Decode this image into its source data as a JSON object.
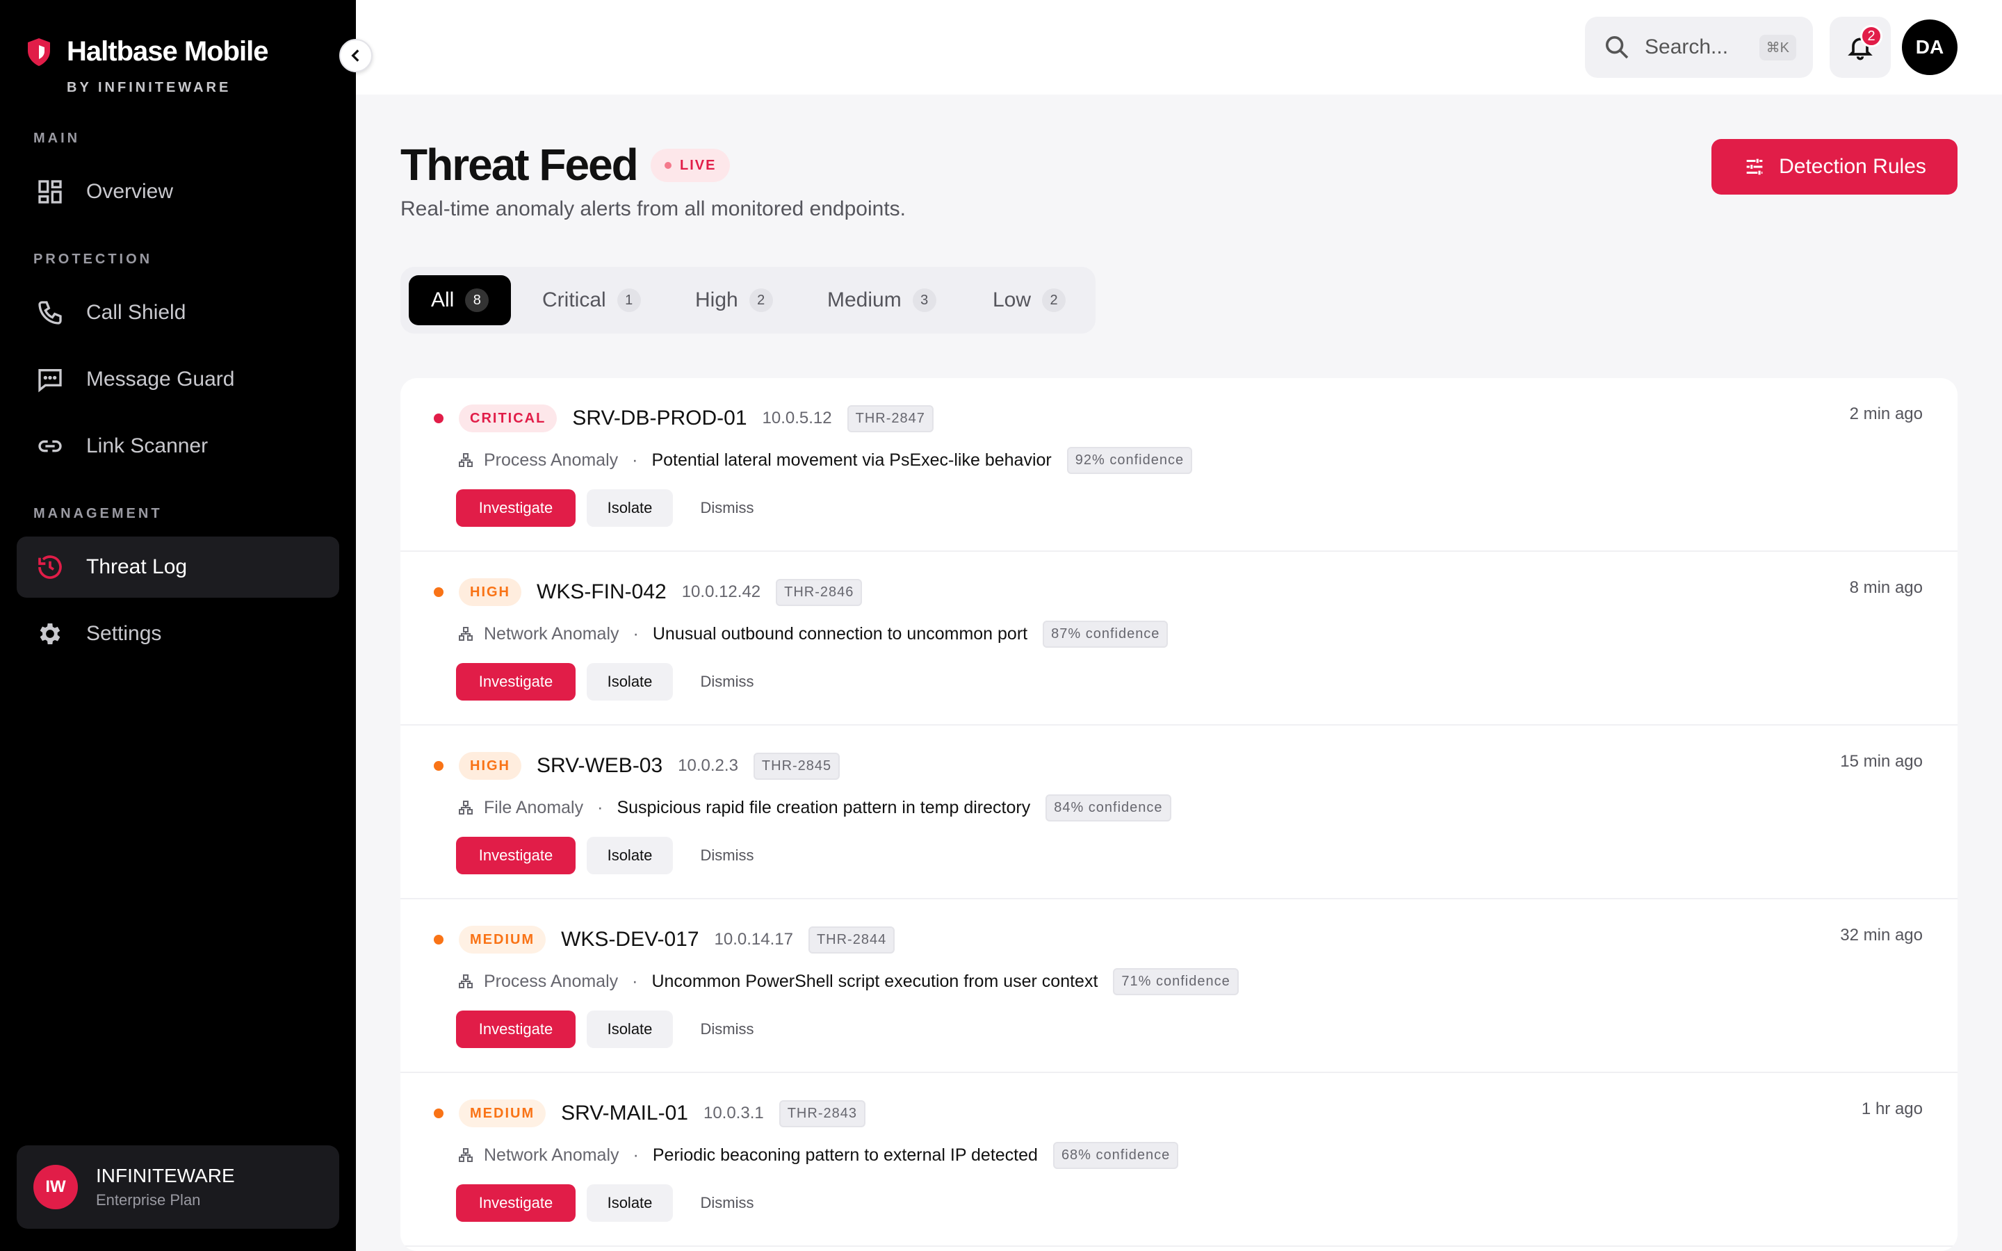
{
  "brand": {
    "name": "Haltbase Mobile",
    "sub": "BY INFINITEWARE"
  },
  "nav": {
    "sections": {
      "main": "MAIN",
      "protection": "PROTECTION",
      "management": "MANAGEMENT"
    },
    "items": [
      {
        "label": "Overview",
        "icon": "grid-icon"
      },
      {
        "label": "Call Shield",
        "icon": "phone-icon"
      },
      {
        "label": "Message Guard",
        "icon": "message-icon"
      },
      {
        "label": "Link Scanner",
        "icon": "link-icon"
      },
      {
        "label": "Threat Log",
        "icon": "history-icon",
        "active": true
      },
      {
        "label": "Settings",
        "icon": "gear-icon"
      }
    ]
  },
  "account": {
    "initials": "IW",
    "name": "INFINITEWARE",
    "plan": "Enterprise Plan"
  },
  "topbar": {
    "search_placeholder": "Search...",
    "shortcut": "⌘K",
    "notifications": "2",
    "user_initials": "DA"
  },
  "page": {
    "title": "Threat Feed",
    "live": "LIVE",
    "subtitle": "Real-time anomaly alerts from all monitored endpoints.",
    "rules_button": "Detection Rules"
  },
  "tabs": [
    {
      "label": "All",
      "count": "8"
    },
    {
      "label": "Critical",
      "count": "1"
    },
    {
      "label": "High",
      "count": "2"
    },
    {
      "label": "Medium",
      "count": "3"
    },
    {
      "label": "Low",
      "count": "2"
    }
  ],
  "colors": {
    "accent": "#e11d48",
    "critical": "#e11d48",
    "high": "#f97316",
    "medium": "#f97316"
  },
  "actions": {
    "investigate": "Investigate",
    "isolate": "Isolate",
    "dismiss": "Dismiss"
  },
  "threats": [
    {
      "severity": "CRITICAL",
      "host": "SRV-DB-PROD-01",
      "ip": "10.0.5.12",
      "id": "THR-2847",
      "time": "2 min ago",
      "category": "Process Anomaly",
      "desc": "Potential lateral movement via PsExec-like behavior",
      "confidence": "92% confidence"
    },
    {
      "severity": "HIGH",
      "host": "WKS-FIN-042",
      "ip": "10.0.12.42",
      "id": "THR-2846",
      "time": "8 min ago",
      "category": "Network Anomaly",
      "desc": "Unusual outbound connection to uncommon port",
      "confidence": "87% confidence"
    },
    {
      "severity": "HIGH",
      "host": "SRV-WEB-03",
      "ip": "10.0.2.3",
      "id": "THR-2845",
      "time": "15 min ago",
      "category": "File Anomaly",
      "desc": "Suspicious rapid file creation pattern in temp directory",
      "confidence": "84% confidence"
    },
    {
      "severity": "MEDIUM",
      "host": "WKS-DEV-017",
      "ip": "10.0.14.17",
      "id": "THR-2844",
      "time": "32 min ago",
      "category": "Process Anomaly",
      "desc": "Uncommon PowerShell script execution from user context",
      "confidence": "71% confidence"
    },
    {
      "severity": "MEDIUM",
      "host": "SRV-MAIL-01",
      "ip": "10.0.3.1",
      "id": "THR-2843",
      "time": "1 hr ago",
      "category": "Network Anomaly",
      "desc": "Periodic beaconing pattern to external IP detected",
      "confidence": "68% confidence"
    }
  ]
}
